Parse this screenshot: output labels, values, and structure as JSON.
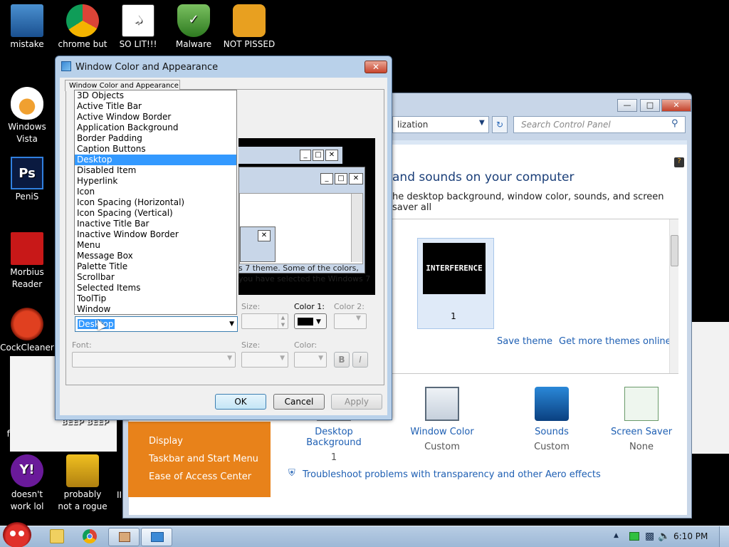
{
  "desktop": {
    "icons": [
      {
        "label": "mistake",
        "icon": "computer-warning-icon"
      },
      {
        "label": "chrome but",
        "icon": "chrome-icon"
      },
      {
        "label": "SO LIT!!!",
        "icon": "cards-icon"
      },
      {
        "label": "Malware",
        "icon": "shield-check-icon"
      },
      {
        "label": "NOT PISSED",
        "icon": "green-pig-icon"
      },
      {
        "label": "Windows Vista",
        "icon": "egg-icon"
      },
      {
        "label": "PeniS",
        "icon": "photoshop-icon"
      },
      {
        "label": "Morbius Reader",
        "icon": "pdf-icon"
      },
      {
        "label": "CockCleaner",
        "icon": "broom-icon"
      },
      {
        "label": "who the fuck uses this",
        "icon": "lightning-icon"
      },
      {
        "label": "doesn't work lol",
        "icon": "yahoo-icon"
      },
      {
        "label": "probably not a rogue",
        "icon": "computer-gears-icon"
      }
    ],
    "partial_label": "BEEP BEEP",
    "partial_label2": "II"
  },
  "personalization": {
    "address_text": "lization",
    "search_placeholder": "Search Control Panel",
    "heading": "and sounds on your computer",
    "subtext": "he desktop background, window color, sounds, and screen saver all",
    "theme_label": "1",
    "theme_thumbnail_text": "INTERFERENCE",
    "save_theme": "Save theme",
    "get_more_themes": "Get more themes online",
    "left_links": [
      "Display",
      "Taskbar and Start Menu",
      "Ease of Access Center"
    ],
    "bottom_items": [
      {
        "title": "Desktop Background",
        "value": "1",
        "icon": "desktop-background-icon"
      },
      {
        "title": "Window Color",
        "value": "Custom",
        "icon": "window-color-icon"
      },
      {
        "title": "Sounds",
        "value": "Custom",
        "icon": "sounds-icon"
      },
      {
        "title": "Screen Saver",
        "value": "None",
        "icon": "screen-saver-icon"
      }
    ],
    "troubleshoot": "Troubleshoot problems with transparency and other Aero effects"
  },
  "dialog": {
    "title": "Window Color and Appearance",
    "tab_label": "Window Color and Appearance",
    "info_text_1": "s 7 theme.  Some of the colors,",
    "info_text_2": "you have selected the Windows 7",
    "item_selected": "Desktop",
    "size_label": "Size:",
    "color1_label": "Color 1:",
    "color2_label": "Color 2:",
    "font_label": "Font:",
    "font_size_label": "Size:",
    "font_color_label": "Color:",
    "bold_label": "B",
    "italic_label": "I",
    "ok": "OK",
    "cancel": "Cancel",
    "apply": "Apply",
    "list_items": [
      "3D Objects",
      "Active Title Bar",
      "Active Window Border",
      "Application Background",
      "Border Padding",
      "Caption Buttons",
      "Desktop",
      "Disabled Item",
      "Hyperlink",
      "Icon",
      "Icon Spacing (Horizontal)",
      "Icon Spacing (Vertical)",
      "Inactive Title Bar",
      "Inactive Window Border",
      "Menu",
      "Message Box",
      "Palette Title",
      "Scrollbar",
      "Selected Items",
      "ToolTip",
      "Window"
    ],
    "selected_index": 6
  },
  "taskbar": {
    "time": "6:10 PM"
  },
  "colors": {
    "selection": "#3399ff",
    "orange_panel": "#e8821a",
    "link": "#1e5fb3"
  }
}
